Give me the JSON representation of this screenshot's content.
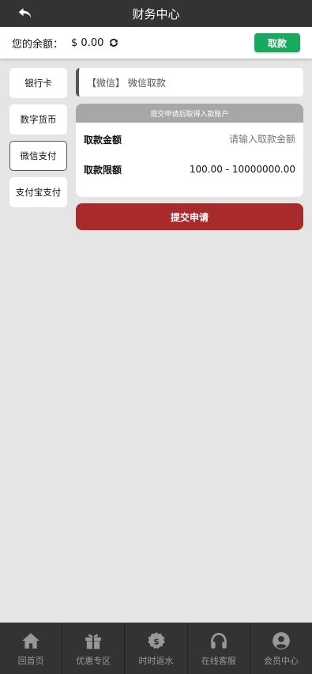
{
  "header": {
    "title": "财务中心",
    "back_icon": "back-arrow-icon"
  },
  "balance": {
    "label": "您的余额：",
    "amount": "$ 0.00",
    "refresh_icon": "refresh-icon",
    "withdraw_label": "取款",
    "withdraw_color": "#18a860"
  },
  "methods": [
    {
      "label": "银行卡",
      "active": false
    },
    {
      "label": "数字货币",
      "active": false
    },
    {
      "label": "微信支付",
      "active": true
    },
    {
      "label": "支付宝支付",
      "active": false
    }
  ],
  "content": {
    "method_label": "【微信】 微信取款",
    "notice": "提交申请后取得入款账户",
    "amount_label": "取款金额",
    "amount_placeholder": "请输入取款金额",
    "limit_label": "取款限额",
    "limit_value": "100.00 - 10000000.00",
    "submit_label": "提交申请",
    "submit_color": "#a82a2a"
  },
  "bottom_nav": [
    {
      "label": "回首页",
      "icon": "home-icon"
    },
    {
      "label": "优惠专区",
      "icon": "gift-icon"
    },
    {
      "label": "时时返水",
      "icon": "dollar-badge-icon"
    },
    {
      "label": "在线客服",
      "icon": "headset-icon"
    },
    {
      "label": "会员中心",
      "icon": "user-icon"
    }
  ]
}
